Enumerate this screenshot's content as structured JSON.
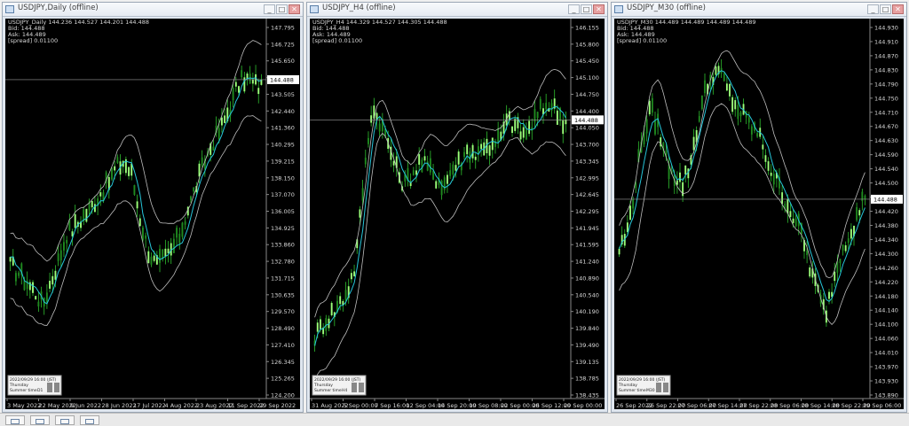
{
  "windows": [
    {
      "title": "USDJPY,Daily (offline)",
      "ohlc": "USDJPY_Daily  144.236 144.527 144.201 144.488",
      "bid": "Bid: 144.488",
      "ask": "Ask: 144.489",
      "spread": "[spread] 0.01100",
      "current_price": "144.488",
      "price_labels": [
        "147.795",
        "146.725",
        "145.650",
        "144.575",
        "143.505",
        "142.440",
        "141.360",
        "140.295",
        "139.215",
        "138.150",
        "137.070",
        "136.005",
        "134.925",
        "133.860",
        "132.780",
        "131.715",
        "130.635",
        "129.570",
        "128.490",
        "127.410",
        "126.345",
        "125.265",
        "124.200"
      ],
      "date_labels": [
        "3 May 2022",
        "22 May 2022",
        "9 Jun 2022",
        "28 Jun 2022",
        "17 Jul 2022",
        "4 Aug 2022",
        "23 Aug 2022",
        "11 Sep 2022",
        "29 Sep 2022"
      ],
      "panel": {
        "line1": "2022/09/29 16:00 (JST)",
        "line2": "Thursday",
        "line3": "Summer time",
        "tf": "D1"
      }
    },
    {
      "title": "USDJPY_H4 (offline)",
      "ohlc": "USDJPY_H4  144.329 144.527 144.305 144.488",
      "bid": "Bid: 144.488",
      "ask": "Ask: 144.489",
      "spread": "[spread] 0.01100",
      "current_price": "144.488",
      "price_labels": [
        "146.155",
        "145.800",
        "145.450",
        "145.100",
        "144.750",
        "144.400",
        "144.050",
        "143.700",
        "143.345",
        "142.995",
        "142.645",
        "142.295",
        "141.945",
        "141.595",
        "141.240",
        "140.890",
        "140.540",
        "140.190",
        "139.840",
        "139.490",
        "139.135",
        "138.785",
        "138.435"
      ],
      "date_labels": [
        "31 Aug 2022",
        "5 Sep 00:00",
        "7 Sep 16:00",
        "12 Sep 04:00",
        "14 Sep 20:00",
        "19 Sep 08:00",
        "22 Sep 00:00",
        "26 Sep 12:00",
        "29 Sep 00:00"
      ],
      "panel": {
        "line1": "2022/09/29 16:00 (JST)",
        "line2": "Thursday",
        "line3": "Summer time",
        "tf": "H4"
      }
    },
    {
      "title": "USDJPY_M30 (offline)",
      "ohlc": "USDJPY_M30  144.489 144.489 144.489 144.489",
      "bid": "Bid: 144.488",
      "ask": "Ask: 144.489",
      "spread": "[spread] 0.01100",
      "current_price": "144.488",
      "price_labels": [
        "144.930",
        "144.910",
        "144.870",
        "144.830",
        "144.790",
        "144.750",
        "144.710",
        "144.670",
        "144.630",
        "144.590",
        "144.540",
        "144.500",
        "144.460",
        "144.420",
        "144.380",
        "144.340",
        "144.300",
        "144.260",
        "144.220",
        "144.180",
        "144.140",
        "144.100",
        "144.060",
        "144.010",
        "143.970",
        "143.930",
        "143.890"
      ],
      "date_labels": [
        "26 Sep 2022",
        "26 Sep 22:00",
        "27 Sep 06:00",
        "27 Sep 14:00",
        "27 Sep 22:00",
        "28 Sep 06:00",
        "28 Sep 14:00",
        "28 Sep 22:00",
        "29 Sep 06:00"
      ],
      "panel": {
        "line1": "2022/09/29 16:00 (JST)",
        "line2": "Thursday",
        "line3": "Summer time",
        "tf": "M30"
      }
    }
  ],
  "colors": {
    "bull_candle": "#9cff7a",
    "bear_candle": "#1f8a1f",
    "wick": "#2fbf2f",
    "ma_line": "#26c6da",
    "bollinger": "#bdbdbd",
    "price_line": "#9a9a9a",
    "background": "#000000",
    "axis_text": "#d8d8d8"
  },
  "window_buttons": {
    "minimize": "_",
    "maximize": "□",
    "close": "✕"
  }
}
